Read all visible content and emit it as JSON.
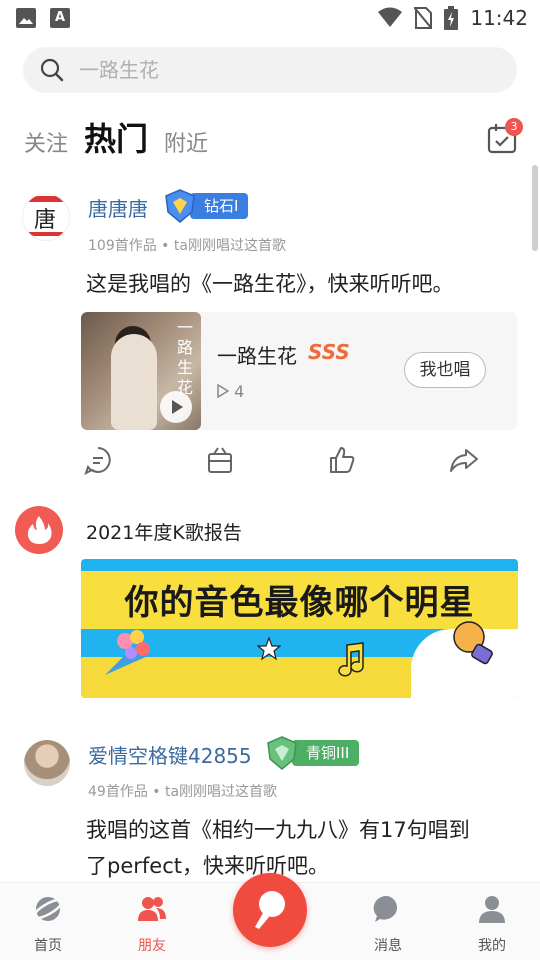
{
  "status_bar": {
    "time": "11:42",
    "icons": [
      "image-icon",
      "a-icon",
      "wifi-icon",
      "no-sim-icon",
      "battery-charging-icon"
    ]
  },
  "search": {
    "placeholder": "一路生花"
  },
  "tabs": [
    {
      "label": "关注",
      "active": false
    },
    {
      "label": "热门",
      "active": true
    },
    {
      "label": "附近",
      "active": false
    }
  ],
  "calendar_badge": "3",
  "feed": {
    "post1": {
      "username": "唐唐唐",
      "level": "钻石I",
      "meta": "109首作品 • ta刚刚唱过这首歌",
      "text": "这是我唱的《一路生花》，快来听听吧。",
      "song": {
        "title": "一路生花",
        "grade": "SSS",
        "plays": "4",
        "sing_label": "我也唱",
        "cover_text": "一路生花"
      }
    },
    "promo": {
      "title": "2021年度K歌报告",
      "banner_text": "你的音色最像哪个明星"
    },
    "post2": {
      "username": "爱情空格键42855",
      "level": "青铜III",
      "meta": "49首作品 • ta刚刚唱过这首歌",
      "text_line1": "我唱的这首《相约一九九八》有17句唱到",
      "text_line2": "了perfect，快来听听吧。"
    }
  },
  "bottom_nav": [
    {
      "label": "首页",
      "icon": "planet-icon",
      "active": false
    },
    {
      "label": "朋友",
      "icon": "friends-icon",
      "active": true
    },
    {
      "label": "",
      "icon": "microphone-icon",
      "active": false
    },
    {
      "label": "消息",
      "icon": "message-icon",
      "active": false
    },
    {
      "label": "我的",
      "icon": "profile-icon",
      "active": false
    }
  ],
  "colors": {
    "accent": "#f0544f",
    "username": "#3b6aa0",
    "diamond": "#3a7fe0",
    "bronze": "#4caf65"
  }
}
